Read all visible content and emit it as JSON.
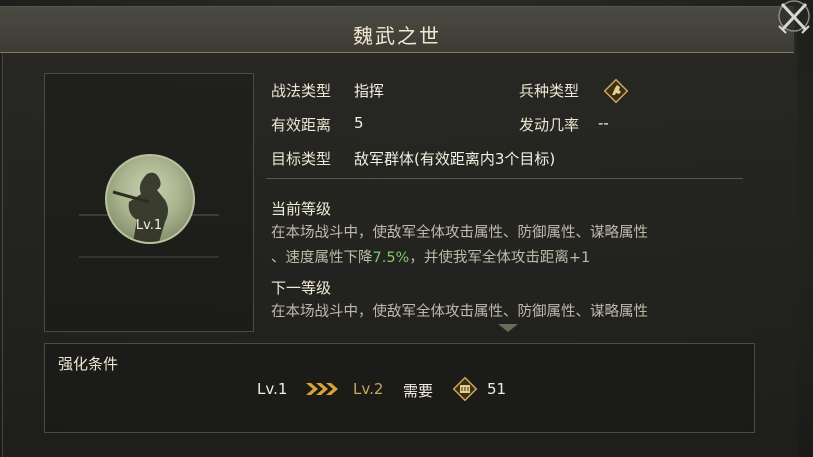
{
  "dialog": {
    "title": "魏武之世"
  },
  "tactic": {
    "portrait_level": "Lv.1",
    "type_label": "战法类型",
    "type_value": "指挥",
    "troop_label": "兵种类型",
    "range_label": "有效距离",
    "range_value": "5",
    "chance_label": "发动几率",
    "chance_value": "--",
    "target_label": "目标类型",
    "target_value": "敌军群体(有效距离内3个目标)"
  },
  "current_level": {
    "heading": "当前等级",
    "line1": "在本场战斗中，使敌军全体攻击属性、防御属性、谋略属性",
    "line2_prefix": "、速度属性下降",
    "line2_value": "7.5%",
    "line2_suffix": "，并使我军全体攻击距离+1"
  },
  "next_level": {
    "heading": "下一等级",
    "line1": "在本场战斗中，使敌军全体攻击属性、防御属性、谋略属性"
  },
  "enhance": {
    "heading": "强化条件",
    "from_level": "Lv.1",
    "to_level": "Lv.2",
    "need_label": "需要",
    "cost": "51"
  },
  "colors": {
    "accent_gold": "#c9a65a",
    "highlight_green": "#7fc96a"
  },
  "icons": {
    "troop_type": "horse-head-icon",
    "cost": "scroll-token-icon",
    "close": "crossed-swords-close-icon",
    "arrow": "triple-chevron-right-icon"
  }
}
